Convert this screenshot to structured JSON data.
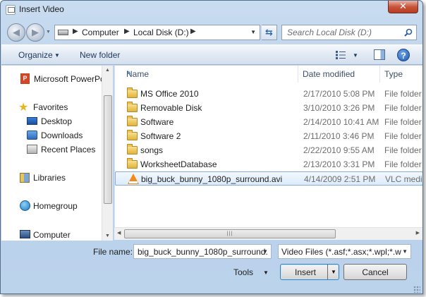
{
  "window": {
    "title": "Insert Video",
    "close_label": "✕"
  },
  "nav": {
    "back_glyph": "◀",
    "forward_glyph": "▶",
    "breadcrumbs": [
      "Computer",
      "Local Disk (D:)"
    ],
    "search_placeholder": "Search Local Disk (D:)"
  },
  "toolbar": {
    "organize_label": "Organize",
    "new_folder_label": "New folder",
    "help_glyph": "?"
  },
  "navpane": {
    "items": [
      {
        "label": "Microsoft PowerPc",
        "icon": "powerpoint-icon"
      },
      {
        "label": "Favorites",
        "icon": "star-icon"
      },
      {
        "label": "Desktop",
        "icon": "desktop-icon"
      },
      {
        "label": "Downloads",
        "icon": "downloads-icon"
      },
      {
        "label": "Recent Places",
        "icon": "recent-places-icon"
      },
      {
        "label": "Libraries",
        "icon": "libraries-icon"
      },
      {
        "label": "Homegroup",
        "icon": "homegroup-icon"
      },
      {
        "label": "Computer",
        "icon": "computer-icon"
      }
    ]
  },
  "filelist": {
    "columns": [
      "Name",
      "Date modified",
      "Type"
    ],
    "rows": [
      {
        "name": "MS Office 2010",
        "date": "2/17/2010 5:08 PM",
        "type": "File folder",
        "icon": "folder-icon"
      },
      {
        "name": "Removable Disk",
        "date": "3/10/2010 3:26 PM",
        "type": "File folder",
        "icon": "folder-icon"
      },
      {
        "name": "Software",
        "date": "2/14/2010 10:41 AM",
        "type": "File folder",
        "icon": "folder-icon"
      },
      {
        "name": "Software 2",
        "date": "2/11/2010 3:46 PM",
        "type": "File folder",
        "icon": "folder-icon"
      },
      {
        "name": "songs",
        "date": "2/22/2010 9:55 AM",
        "type": "File folder",
        "icon": "folder-icon"
      },
      {
        "name": "WorksheetDatabase",
        "date": "2/13/2010 3:31 PM",
        "type": "File folder",
        "icon": "folder-icon"
      },
      {
        "name": "big_buck_bunny_1080p_surround.avi",
        "date": "4/14/2009 2:51 PM",
        "type": "VLC medi",
        "icon": "vlc-icon"
      }
    ]
  },
  "bottom": {
    "file_name_label": "File name:",
    "file_name_value": "big_buck_bunny_1080p_surround.",
    "file_type_value": "Video Files (*.asf;*.asx;*.wpl;*.w",
    "tools_label": "Tools",
    "insert_label": "Insert",
    "cancel_label": "Cancel"
  }
}
